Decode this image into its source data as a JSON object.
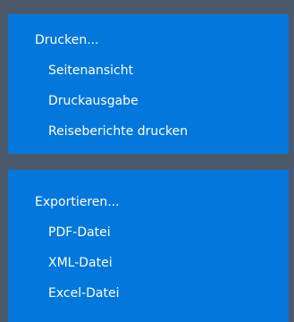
{
  "print_section": {
    "header": "Drucken...",
    "items": [
      {
        "label": "Seitenansicht"
      },
      {
        "label": "Druckausgabe"
      },
      {
        "label": "Reiseberichte drucken"
      }
    ]
  },
  "export_section": {
    "header": "Exportieren...",
    "items": [
      {
        "label": "PDF-Datei"
      },
      {
        "label": "XML-Datei"
      },
      {
        "label": "Excel-Datei"
      }
    ]
  },
  "colors": {
    "background": "#4c596b",
    "panel": "#0377db",
    "text": "#ffffff"
  }
}
